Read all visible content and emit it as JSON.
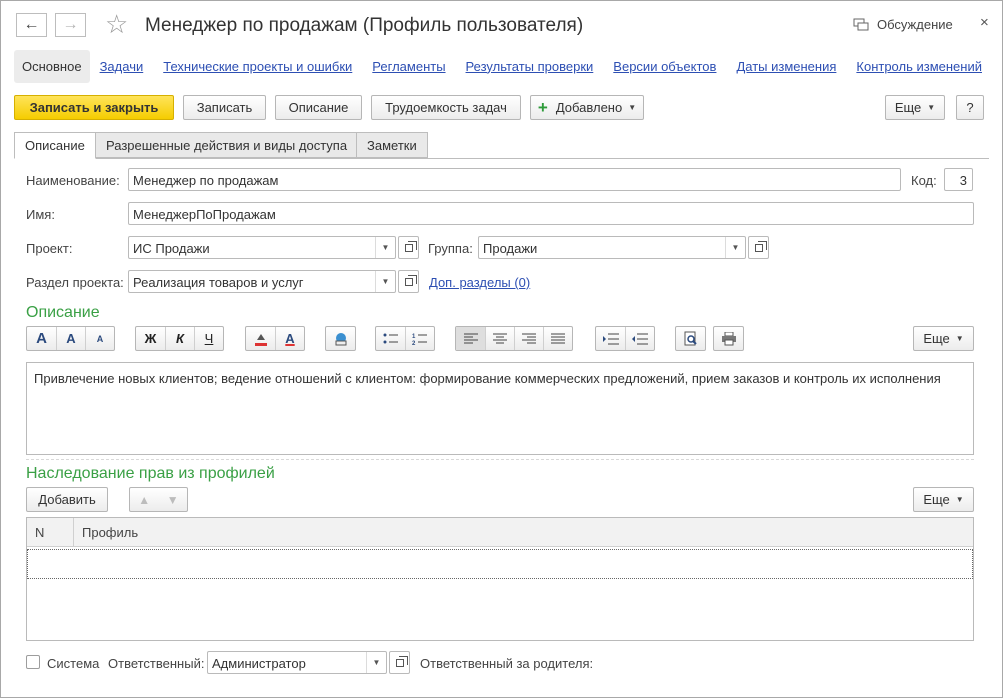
{
  "window": {
    "title": "Менеджер по продажам (Профиль пользователя)",
    "discussion_label": "Обсуждение",
    "close_glyph": "×",
    "back_glyph": "←",
    "forward_glyph": "→",
    "star_glyph": "☆"
  },
  "nav_links": {
    "active": "Основное",
    "items": [
      "Задачи",
      "Технические проекты и ошибки",
      "Регламенты",
      "Результаты проверки",
      "Версии объектов",
      "Даты изменения",
      "Контроль изменений"
    ]
  },
  "toolbar": {
    "save_close": "Записать и закрыть",
    "save": "Записать",
    "description": "Описание",
    "labor": "Трудоемкость задач",
    "added": "Добавлено",
    "plus_glyph": "+",
    "more": "Еще",
    "help": "?"
  },
  "tabs": [
    "Описание",
    "Разрешенные действия и виды доступа",
    "Заметки"
  ],
  "form": {
    "name_label": "Наименование:",
    "name_value": "Менеджер по продажам",
    "code_label": "Код:",
    "code_value": "3",
    "id_label": "Имя:",
    "id_value": "МенеджерПоПродажам",
    "project_label": "Проект:",
    "project_value": "ИС Продажи",
    "group_label": "Группа:",
    "group_value": "Продажи",
    "section_label": "Раздел проекта:",
    "section_value": "Реализация товаров и услуг",
    "extra_sections_link": "Доп. разделы (0)"
  },
  "description_section": {
    "title": "Описание",
    "text": "Привлечение новых клиентов; ведение отношений с клиентом: формирование коммерческих предложений, прием заказов и контроль их исполнения",
    "more": "Еще",
    "fmt": {
      "font_big": "A",
      "font_inc": "A",
      "font_dec": "A",
      "bold": "Ж",
      "italic": "К",
      "underline": "Ч",
      "text_color": "A"
    }
  },
  "inheritance_section": {
    "title": "Наследование прав из профилей",
    "add_button": "Добавить",
    "more": "Еще",
    "up_glyph": "▲",
    "down_glyph": "▼",
    "columns": [
      "N",
      "Профиль"
    ]
  },
  "footer": {
    "system_label": "Система",
    "responsible_label": "Ответственный:",
    "responsible_value": "Администратор",
    "parent_responsible_label": "Ответственный за родителя:"
  }
}
